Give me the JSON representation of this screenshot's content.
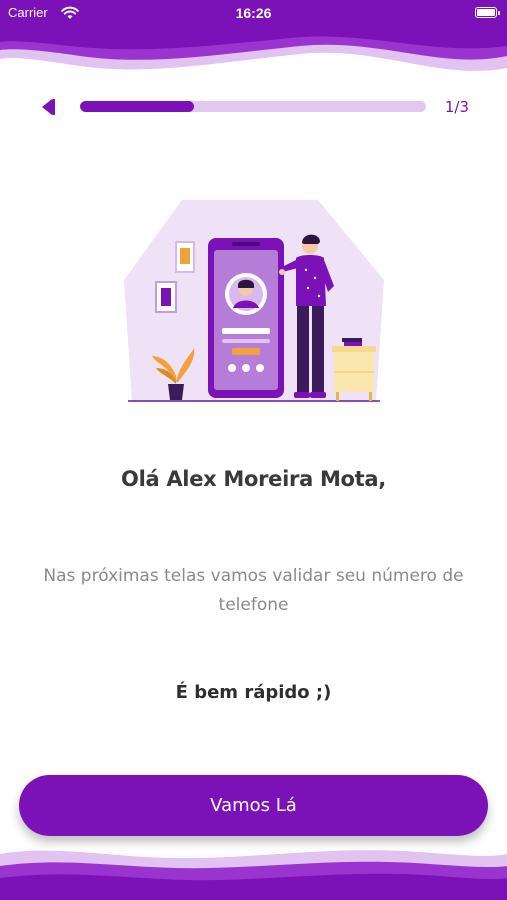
{
  "status_bar": {
    "carrier": "Carrier",
    "time": "16:26"
  },
  "progress": {
    "step_label": "1/3",
    "fraction": 0.33
  },
  "content": {
    "greeting": "Olá Alex Moreira Mota,",
    "description": "Nas próximas telas vamos validar seu número de telefone",
    "note": "É bem rápido ;)"
  },
  "cta": {
    "label": "Vamos Lá"
  },
  "colors": {
    "primary": "#7b12b8",
    "light": "#e4c6f2",
    "accent": "#f2a23c"
  },
  "icons": [
    "wifi-icon",
    "battery-icon",
    "back-arrow-icon"
  ]
}
